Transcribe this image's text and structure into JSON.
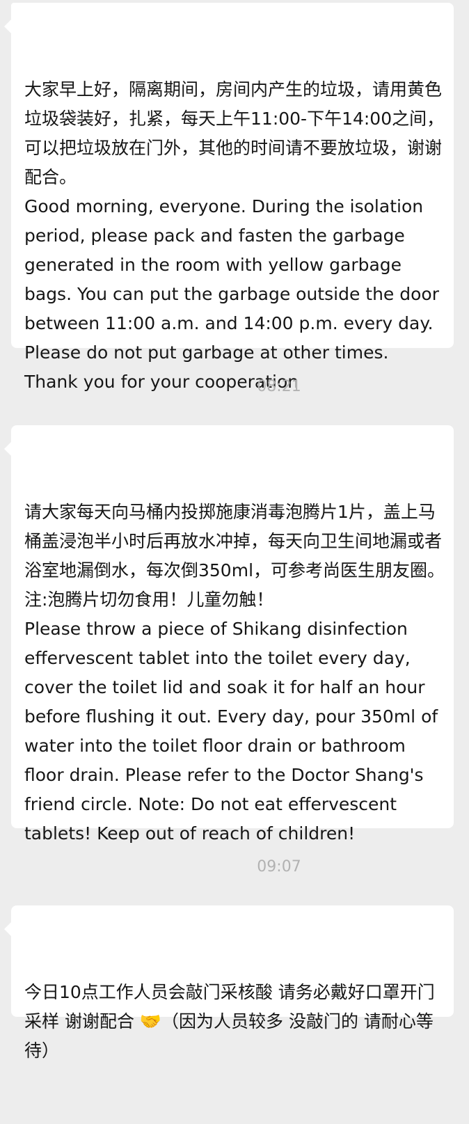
{
  "messages": [
    {
      "text": "大家早上好，隔离期间，房间内产生的垃圾，请用黄色垃圾袋装好，扎紧，每天上午11:00-下午14:00之间，可以把垃圾放在门外，其他的时间请不要放垃圾，谢谢配合。\nGood morning, everyone. During the isolation period, please pack and fasten the garbage generated in the room with yellow garbage bags. You can put the garbage outside the door between 11:00 a.m. and 14:00 p.m. every day. Please do not put garbage at other times. Thank you for your cooperation"
    },
    {
      "text": "请大家每天向马桶内投掷施康消毒泡腾片1片，盖上马桶盖浸泡半小时后再放水冲掉，每天向卫生间地漏或者浴室地漏倒水，每次倒350ml，可参考尚医生朋友圈。注:泡腾片切勿食用！儿童勿触！\nPlease throw a piece of Shikang disinfection effervescent tablet into the toilet every day, cover the toilet lid and soak it for half an hour before flushing it out. Every day, pour 350ml of water into the toilet floor drain or bathroom floor drain. Please refer to the Doctor Shang's friend circle. Note: Do not eat effervescent tablets! Keep out of reach of children!"
    },
    {
      "text": "今日10点工作人员会敲门采核酸 请务必戴好口罩开门采样 谢谢配合 🤝（因为人员较多 没敲门的 请耐心等待）"
    }
  ],
  "timestamps": [
    "08:21",
    "09:07"
  ],
  "colors": {
    "background": "#ededed",
    "bubble": "#ffffff",
    "text": "#161616",
    "timestamp": "#b2b2b2"
  }
}
